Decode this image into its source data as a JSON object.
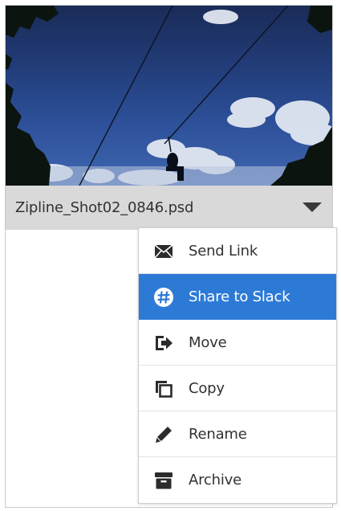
{
  "file": {
    "name": "Zipline_Shot02_0846.psd"
  },
  "menu": {
    "items": [
      {
        "label": "Send Link",
        "icon": "envelope-icon"
      },
      {
        "label": "Share to Slack",
        "icon": "slack-icon"
      },
      {
        "label": "Move",
        "icon": "move-arrow-icon"
      },
      {
        "label": "Copy",
        "icon": "copy-icon"
      },
      {
        "label": "Rename",
        "icon": "pencil-icon"
      },
      {
        "label": "Archive",
        "icon": "archive-box-icon"
      }
    ],
    "selected_index": 1
  },
  "colors": {
    "highlight": "#2d7ad6",
    "file_bar": "#d9d9d9",
    "text": "#323232",
    "sky": "#2d5099"
  }
}
